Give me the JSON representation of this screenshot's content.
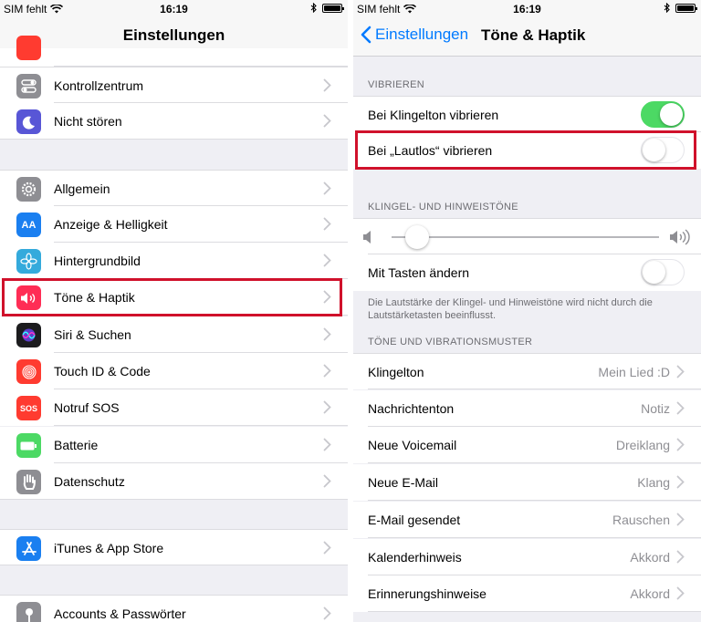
{
  "status": {
    "carrier": "SIM fehlt",
    "time": "16:19"
  },
  "left": {
    "title": "Einstellungen",
    "items": [
      {
        "label": "Kontrollzentrum",
        "icon": "control-center-icon",
        "color": "#8e8e93"
      },
      {
        "label": "Nicht stören",
        "icon": "moon-icon",
        "color": "#5856d6"
      },
      {
        "label": "Allgemein",
        "icon": "gear-icon",
        "color": "#8e8e93"
      },
      {
        "label": "Anzeige & Helligkeit",
        "icon": "text-size-icon",
        "color": "#1a7ff0",
        "glyph": "AA"
      },
      {
        "label": "Hintergrundbild",
        "icon": "flower-icon",
        "color": "#34aadc"
      },
      {
        "label": "Töne & Haptik",
        "icon": "speaker-icon",
        "color": "#ff2d55"
      },
      {
        "label": "Siri & Suchen",
        "icon": "siri-icon",
        "color": "#1c1c1e"
      },
      {
        "label": "Touch ID & Code",
        "icon": "fingerprint-icon",
        "color": "#ff3b30"
      },
      {
        "label": "Notruf SOS",
        "icon": "sos-icon",
        "color": "#ff3b30",
        "glyph": "SOS"
      },
      {
        "label": "Batterie",
        "icon": "battery-icon",
        "color": "#4cd964"
      },
      {
        "label": "Datenschutz",
        "icon": "hand-icon",
        "color": "#8e8e93"
      },
      {
        "label": "iTunes & App Store",
        "icon": "app-store-icon",
        "color": "#1a7ff0"
      },
      {
        "label": "Accounts & Passwörter",
        "icon": "key-icon",
        "color": "#8e8e93"
      }
    ]
  },
  "right": {
    "back_label": "Einstellungen",
    "title": "Töne & Haptik",
    "section_vibrieren": "VIBRIEREN",
    "vibrate_ring": {
      "label": "Bei Klingelton vibrieren",
      "on": true
    },
    "vibrate_silent": {
      "label": "Bei „Lautlos“ vibrieren",
      "on": false
    },
    "section_klingel": "KLINGEL- UND HINWEISTÖNE",
    "volume_level": 0.05,
    "buttons_change": {
      "label": "Mit Tasten ändern",
      "on": false
    },
    "footnote": "Die Lautstärke der Klingel- und Hinweistöne wird nicht durch die Lautstärketasten beeinflusst.",
    "section_patterns": "TÖNE UND VIBRATIONSMUSTER",
    "patterns": [
      {
        "label": "Klingelton",
        "value": "Mein Lied :D"
      },
      {
        "label": "Nachrichtenton",
        "value": "Notiz"
      },
      {
        "label": "Neue Voicemail",
        "value": "Dreiklang"
      },
      {
        "label": "Neue E-Mail",
        "value": "Klang"
      },
      {
        "label": "E-Mail gesendet",
        "value": "Rauschen"
      },
      {
        "label": "Kalenderhinweis",
        "value": "Akkord"
      },
      {
        "label": "Erinnerungshinweise",
        "value": "Akkord"
      }
    ]
  },
  "highlight_color": "#d0112b"
}
